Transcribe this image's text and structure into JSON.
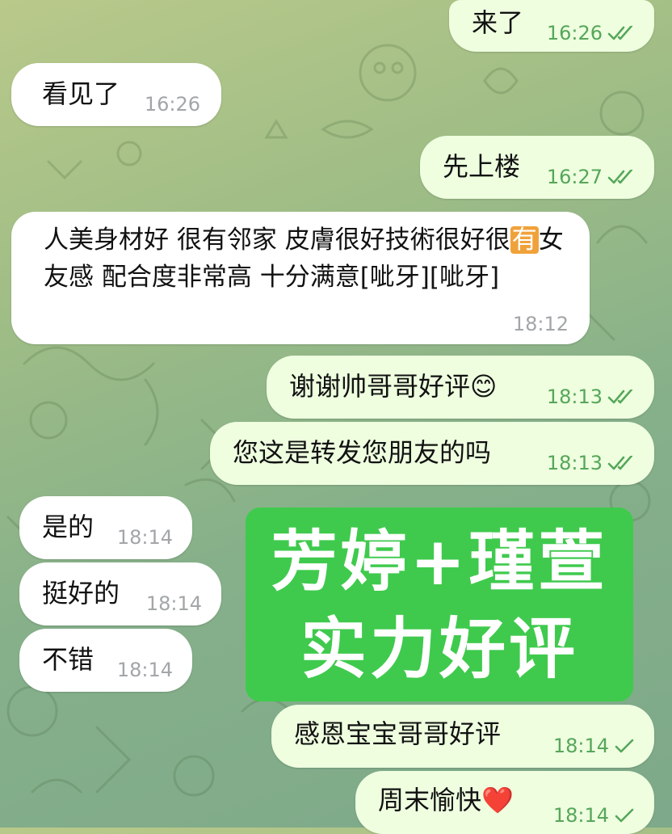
{
  "messages": [
    {
      "text": "来了",
      "time": "16:26",
      "status": "read"
    },
    {
      "text": "看见了",
      "time": "16:26"
    },
    {
      "text": "先上楼",
      "time": "16:27",
      "status": "read"
    },
    {
      "text_part1": "人美身材好 很有邻家 皮膚很好技術很好很",
      "emoji_text": "有",
      "text_part2": "女友感 配合度非常高 十分满意[呲牙][呲牙]",
      "time": "18:12"
    },
    {
      "text": "谢谢帅哥哥好评",
      "emoji": "😊",
      "time": "18:13",
      "status": "read"
    },
    {
      "text": "您这是转发您朋友的吗",
      "time": "18:13",
      "status": "read"
    },
    {
      "text": "是的",
      "time": "18:14"
    },
    {
      "text": "挺好的",
      "time": "18:14"
    },
    {
      "text": "不错",
      "time": "18:14"
    },
    {
      "text": "感恩宝宝哥哥好评",
      "time": "18:14",
      "status": "sent"
    },
    {
      "text": "周末愉快",
      "emoji": "❤️",
      "time": "18:14",
      "status": "sent"
    }
  ],
  "banner": {
    "line1": "芳婷+瑾萱",
    "line2": "实力好评",
    "color": "#3fca4d"
  },
  "colors": {
    "incoming_bubble": "#ffffff",
    "outgoing_bubble": "#eefedf",
    "check_color": "#56a65a",
    "time_gray": "#a2a6a8"
  },
  "icons": {
    "read": "double-check-icon",
    "sent": "single-check-icon"
  }
}
